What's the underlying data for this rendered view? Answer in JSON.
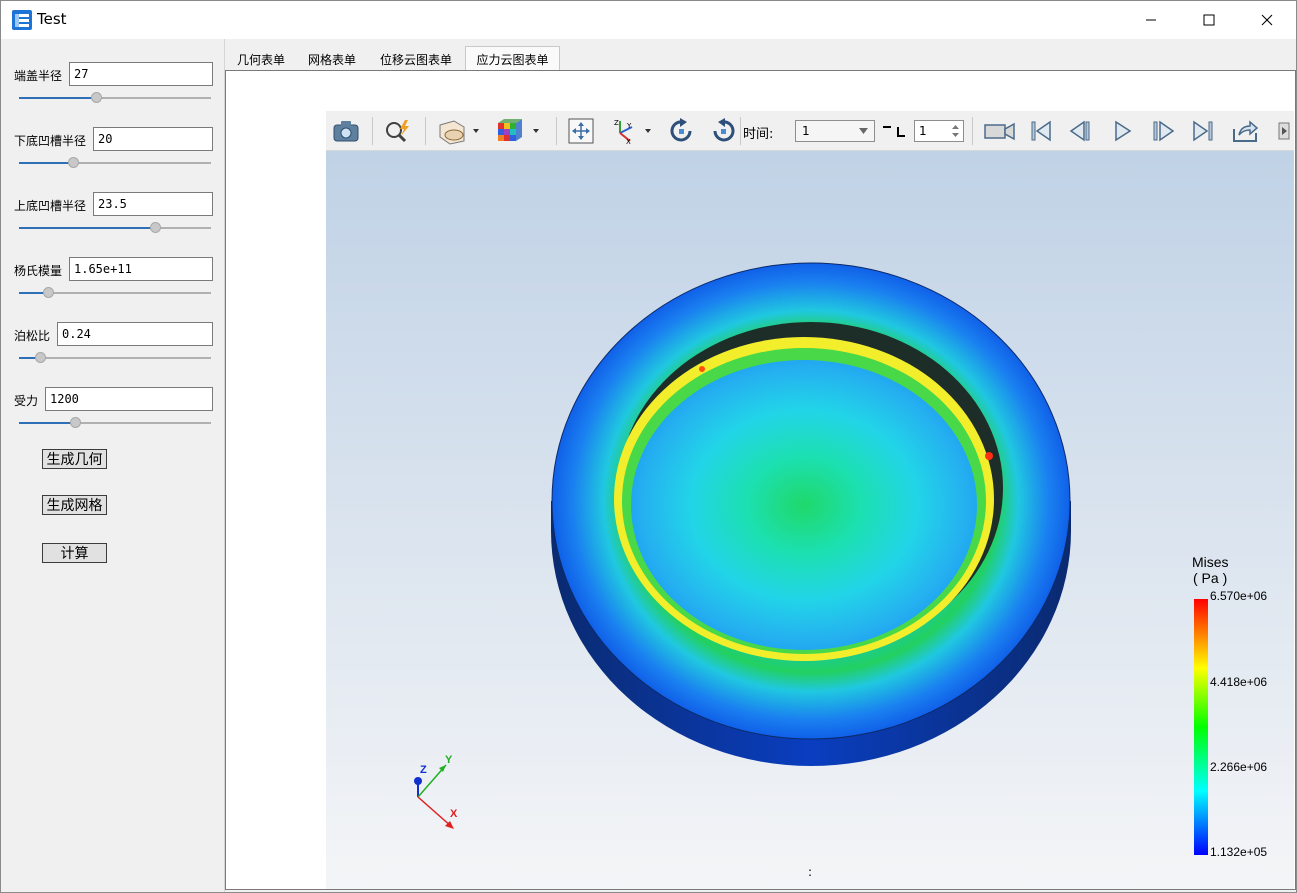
{
  "window": {
    "title": "Test"
  },
  "params": [
    {
      "label": "端盖半径",
      "value": "27",
      "slider_fraction": 0.4
    },
    {
      "label": "下底凹槽半径",
      "value": "20",
      "slider_fraction": 0.28
    },
    {
      "label": "上底凹槽半径",
      "value": "23.5",
      "slider_fraction": 0.71
    },
    {
      "label": "杨氏模量",
      "value": "1.65e+11",
      "slider_fraction": 0.15
    },
    {
      "label": "泊松比",
      "value": "0.24",
      "slider_fraction": 0.11
    },
    {
      "label": "受力",
      "value": "1200",
      "slider_fraction": 0.29
    }
  ],
  "buttons": {
    "geometry": "生成几何",
    "mesh": "生成网格",
    "compute": "计算"
  },
  "tabs": [
    "几何表单",
    "网格表单",
    "位移云图表单",
    "应力云图表单"
  ],
  "active_tab": "应力云图表单",
  "toolbar": {
    "time_label": "时间:",
    "time_value": "1",
    "frame_value": "1"
  },
  "legend": {
    "title_line1": "Mises",
    "title_line2": "( Pa )",
    "labels": [
      "6.570e+06",
      "4.418e+06",
      "2.266e+06",
      "1.132e+05"
    ],
    "colors": [
      "#ff0000",
      "#ffff00",
      "#00ff00",
      "#00ffff",
      "#0000ff"
    ]
  },
  "axes": {
    "x": "X",
    "y": "Y",
    "z": "Z"
  },
  "status_text": ":"
}
